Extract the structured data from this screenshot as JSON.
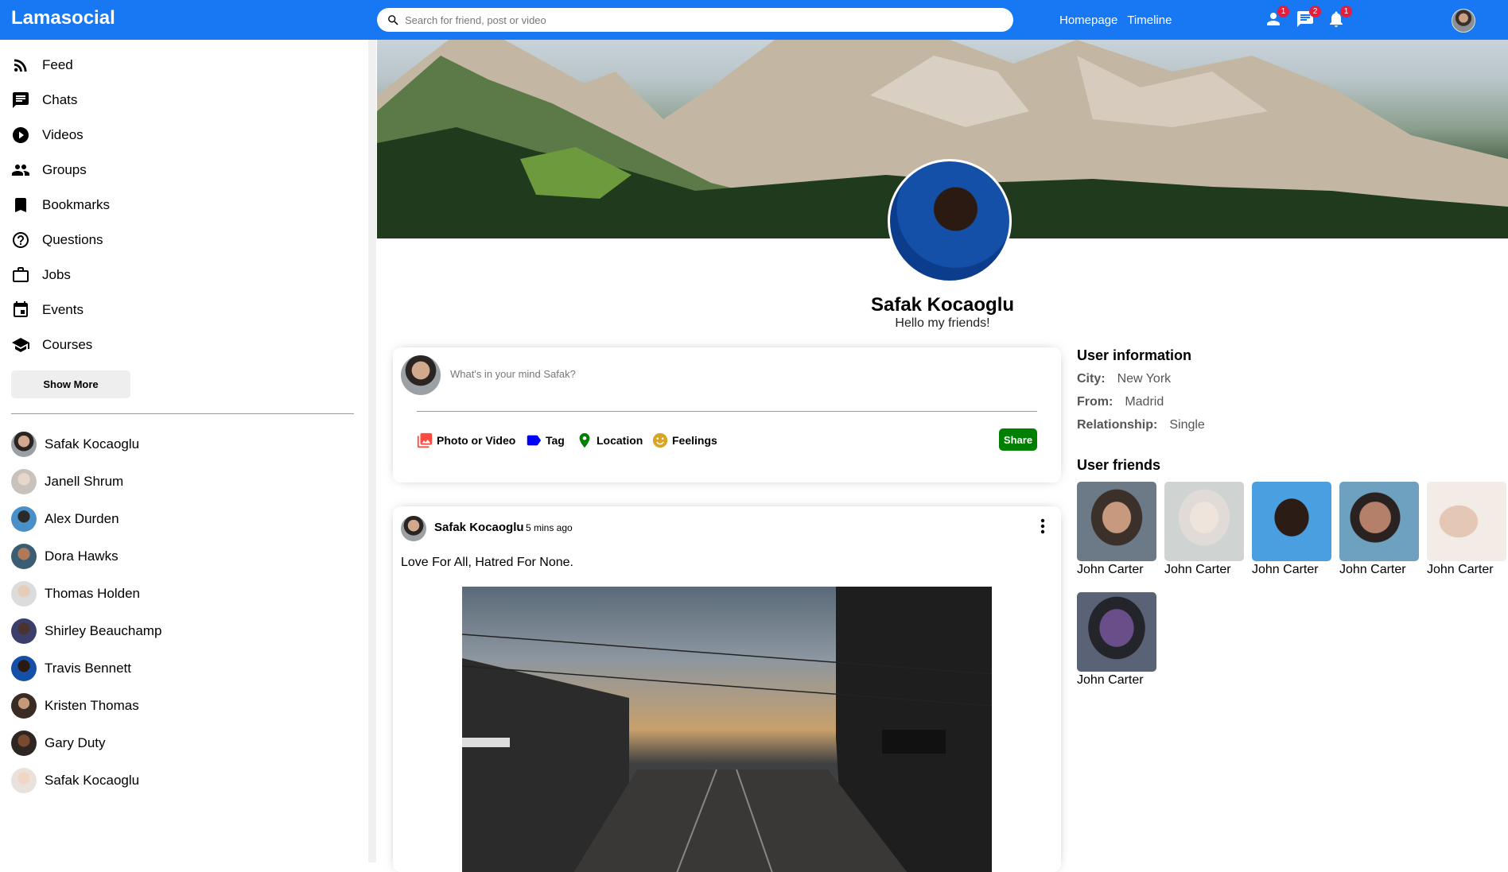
{
  "topbar": {
    "logo": "Lamasocial",
    "search_placeholder": "Search for friend, post or video",
    "links": [
      "Homepage",
      "Timeline"
    ],
    "badges": {
      "person": "1",
      "chat": "2",
      "notifications": "1"
    }
  },
  "sidebar": {
    "items": [
      {
        "label": "Feed",
        "icon": "rss-feed-icon"
      },
      {
        "label": "Chats",
        "icon": "chat-icon"
      },
      {
        "label": "Videos",
        "icon": "play-circle-icon"
      },
      {
        "label": "Groups",
        "icon": "group-icon"
      },
      {
        "label": "Bookmarks",
        "icon": "bookmark-icon"
      },
      {
        "label": "Questions",
        "icon": "help-outline-icon"
      },
      {
        "label": "Jobs",
        "icon": "work-outline-icon"
      },
      {
        "label": "Events",
        "icon": "event-icon"
      },
      {
        "label": "Courses",
        "icon": "school-icon"
      }
    ],
    "show_more": "Show More",
    "friends": [
      "Safak Kocaoglu",
      "Janell Shrum",
      "Alex Durden",
      "Dora Hawks",
      "Thomas Holden",
      "Shirley Beauchamp",
      "Travis Bennett",
      "Kristen Thomas",
      "Gary Duty",
      "Safak Kocaoglu"
    ]
  },
  "profile": {
    "name": "Safak Kocaoglu",
    "desc": "Hello my friends!"
  },
  "share": {
    "placeholder": "What's in your mind Safak?",
    "options": [
      "Photo or Video",
      "Tag",
      "Location",
      "Feelings"
    ],
    "button": "Share",
    "colors": {
      "photo": "#ff4a3d",
      "tag": "#0000ff",
      "location": "#008000",
      "feelings": "#daa520"
    }
  },
  "post": {
    "username": "Safak Kocaoglu",
    "time": "5 mins ago",
    "text": "Love For All, Hatred For None."
  },
  "rightbar": {
    "info_title": "User information",
    "info": [
      {
        "key": "City:",
        "value": "New York"
      },
      {
        "key": "From:",
        "value": "Madrid"
      },
      {
        "key": "Relationship:",
        "value": "Single"
      }
    ],
    "friends_title": "User friends",
    "friends": [
      "John Carter",
      "John Carter",
      "John Carter",
      "John Carter",
      "John Carter",
      "John Carter"
    ]
  }
}
